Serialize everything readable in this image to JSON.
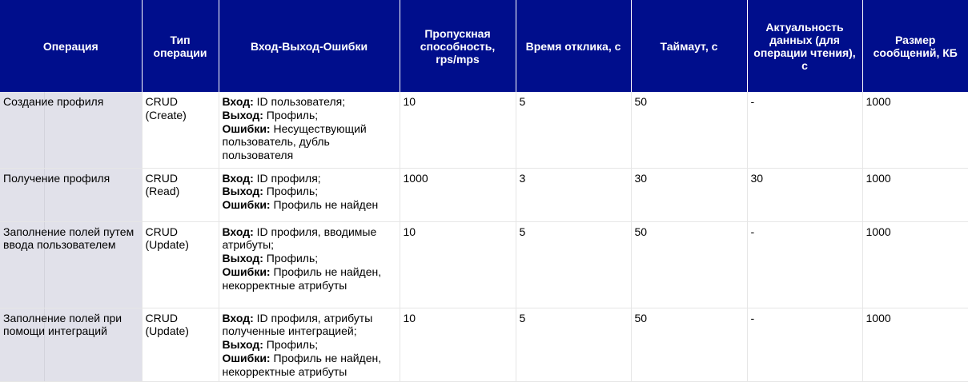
{
  "headers": {
    "operation": "Операция",
    "op_type": "Тип операции",
    "io_errors": "Вход-Выход-Ошибки",
    "throughput": "Пропускная способность, rps/mps",
    "response_time": "Время отклика, с",
    "timeout": "Таймаут, с",
    "freshness": "Актуальность данных (для операции чтения), с",
    "message_size": "Размер сообщений, КБ"
  },
  "labels": {
    "input": "Вход:",
    "output": "Выход:",
    "errors": "Ошибки:"
  },
  "rows": [
    {
      "operation": "Создание профиля",
      "op_type": "CRUD (Create)",
      "input": " ID пользователя;",
      "output": " Профиль;",
      "errors": " Несуществующий пользователь, дубль пользователя",
      "throughput": "10",
      "response_time": "5",
      "timeout": "50",
      "freshness": "-",
      "message_size": "1000"
    },
    {
      "operation": "Получение профиля",
      "op_type": "CRUD (Read)",
      "input": " ID профиля;",
      "output": " Профиль;",
      "errors": " Профиль не найден",
      "throughput": "1000",
      "response_time": "3",
      "timeout": "30",
      "freshness": "30",
      "message_size": "1000"
    },
    {
      "operation": "Заполнение полей путем ввода пользователем",
      "op_type": "CRUD (Update)",
      "input": " ID профиля, вводимые атрибуты;",
      "output": " Профиль;",
      "errors": " Профиль не найден, некорректные атрибуты",
      "throughput": "10",
      "response_time": "5",
      "timeout": "50",
      "freshness": "-",
      "message_size": "1000"
    },
    {
      "operation": "Заполнение полей при помощи интеграций",
      "op_type": "CRUD (Update)",
      "input": " ID профиля, атрибуты полученные интеграцией;",
      "output": " Профиль;",
      "errors": " Профиль не найден, некорректные атрибуты",
      "throughput": "10",
      "response_time": "5",
      "timeout": "50",
      "freshness": "-",
      "message_size": "1000"
    }
  ]
}
